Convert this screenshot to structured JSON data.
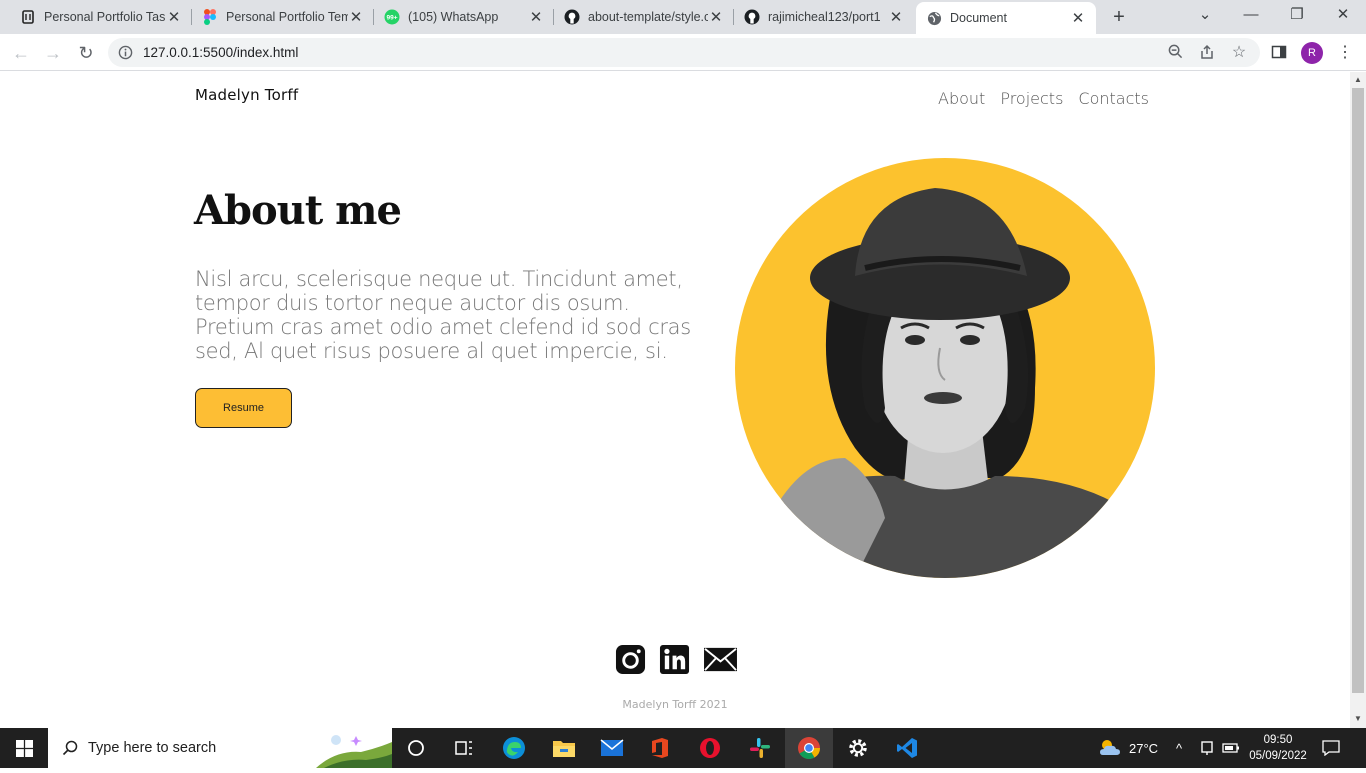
{
  "browser": {
    "tabs": [
      {
        "label": "Personal Portfolio Task",
        "icon": "notion-icon"
      },
      {
        "label": "Personal Portfolio Tem",
        "icon": "figma-icon"
      },
      {
        "label": "(105) WhatsApp",
        "icon": "whatsapp-icon",
        "badge": "99+"
      },
      {
        "label": "about-template/style.c",
        "icon": "github-icon"
      },
      {
        "label": "rajimicheal123/port1",
        "icon": "github-icon"
      },
      {
        "label": "Document",
        "icon": "globe-icon",
        "active": true
      }
    ],
    "url": "127.0.0.1:5500/index.html",
    "profile_initial": "R"
  },
  "site": {
    "brand": "Madelyn Torff",
    "nav": [
      "About",
      "Projects",
      "Contacts"
    ],
    "hero": {
      "title": "About me",
      "text": "Nisl arcu, scelerisque neque ut. Tincidunt amet, tempor duis tortor neque auctor dis osum. Pretium cras amet odio amet clefend id sod cras sed, Al quet risus posuere al quet impercie, si.",
      "button": "Resume"
    },
    "social": [
      "instagram-icon",
      "linkedin-icon",
      "mail-icon"
    ],
    "footer": "Madelyn Torff 2021"
  },
  "taskbar": {
    "search_placeholder": "Type here to search",
    "weather": "27°C",
    "time": "09:50",
    "date": "05/09/2022"
  },
  "colors": {
    "accent": "#fdbe34",
    "portrait_bg": "#fcc22e",
    "taskbar": "#202020"
  }
}
